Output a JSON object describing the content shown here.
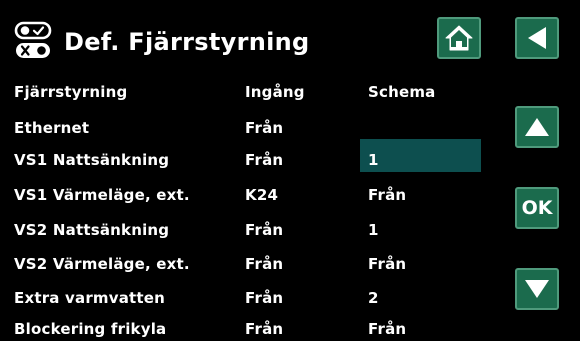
{
  "header": {
    "title": "Def. Fjärrstyrning"
  },
  "buttons": {
    "home": "home",
    "back": "back",
    "up": "up",
    "ok": "OK",
    "down": "down"
  },
  "columns": {
    "name": "Fjärrstyrning",
    "input": "Ingång",
    "schedule": "Schema"
  },
  "rows": [
    {
      "name": "Ethernet",
      "input": "Från",
      "schedule": ""
    },
    {
      "name": "VS1 Nattsänkning",
      "input": "Från",
      "schedule": "1"
    },
    {
      "name": "VS1 Värmeläge, ext.",
      "input": "K24",
      "schedule": "Från"
    },
    {
      "name": "VS2 Nattsänkning",
      "input": "Från",
      "schedule": "1"
    },
    {
      "name": "VS2 Värmeläge, ext.",
      "input": "Från",
      "schedule": "Från"
    },
    {
      "name": "Extra varmvatten",
      "input": "Från",
      "schedule": "2"
    },
    {
      "name": "Blockering frikyla",
      "input": "Från",
      "schedule": "Från"
    }
  ],
  "colors": {
    "button": "#1b6b4d",
    "selection": "#0d4f4f",
    "background": "#000000"
  }
}
